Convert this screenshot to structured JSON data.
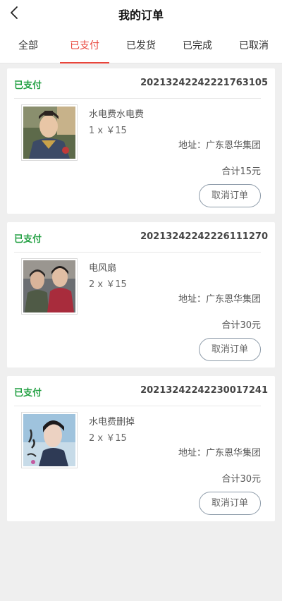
{
  "header": {
    "title": "我的订单",
    "back_icon": "chevron-left-icon"
  },
  "tabs": [
    {
      "label": "全部",
      "active": false
    },
    {
      "label": "已支付",
      "active": true
    },
    {
      "label": "已发货",
      "active": false
    },
    {
      "label": "已完成",
      "active": false
    },
    {
      "label": "已取消",
      "active": false
    }
  ],
  "orders": [
    {
      "status": "已支付",
      "order_no": "20213242242221763105",
      "product_name": "水电费水电费",
      "quantity_price": "1 x ￥15",
      "address": "地址：广东恩华集团",
      "total": "合计15元",
      "cancel_label": "取消订单",
      "image": "product-photo-costume-portrait"
    },
    {
      "status": "已支付",
      "order_no": "20213242242226111270",
      "product_name": "电风扇",
      "quantity_price": "2 x ￥15",
      "address": "地址：广东恩华集团",
      "total": "合计30元",
      "cancel_label": "取消订单",
      "image": "product-photo-two-people"
    },
    {
      "status": "已支付",
      "order_no": "20213242242230017241",
      "product_name": "水电费删掉",
      "quantity_price": "2 x ￥15",
      "address": "地址：广东恩华集团",
      "total": "合计30元",
      "cancel_label": "取消订单",
      "image": "product-photo-album-cover"
    }
  ],
  "colors": {
    "accent": "#e8443a",
    "status_paid": "#23a043",
    "background": "#efefef"
  }
}
